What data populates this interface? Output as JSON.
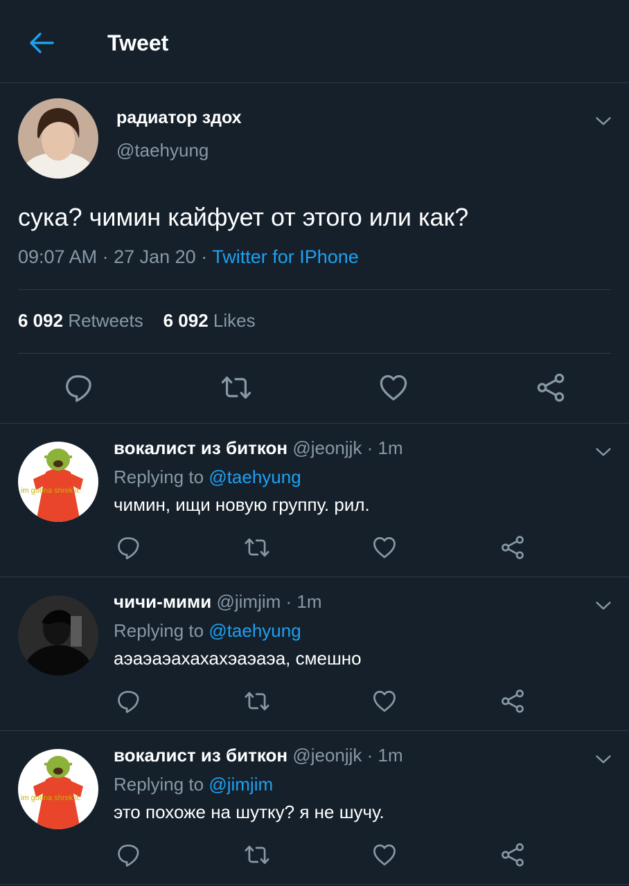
{
  "header": {
    "title": "Tweet"
  },
  "tweet": {
    "author_name": "радиатор здох",
    "author_handle": "@taehyung",
    "text": "сука? чимин кайфует от этого или как?",
    "time": "09:07 AM",
    "date": "27 Jan 20",
    "source": "Twitter for IPhone",
    "sep": " · ",
    "retweets_count": "6 092",
    "retweets_label": "Retweets",
    "likes_count": "6 092",
    "likes_label": "Likes"
  },
  "replies": [
    {
      "name": "вокалист из биткон",
      "handle": "@jeonjjk",
      "time": "1m",
      "replying_prefix": "Replying to ",
      "replying_to": "@taehyung",
      "text": "чимин, ищи новую группу. рил.",
      "avatar_caption": "im gonna shrek it."
    },
    {
      "name": "чичи-мими",
      "handle": "@jimjim",
      "time": "1m",
      "replying_prefix": "Replying to ",
      "replying_to": "@taehyung",
      "text": "аэаэаэахахахэаэаэа, смешно"
    },
    {
      "name": "вокалист из биткон",
      "handle": "@jeonjjk",
      "time": "1m",
      "replying_prefix": "Replying to ",
      "replying_to": "@jimjim",
      "text": "это похоже на шутку? я не шучу.",
      "avatar_caption": "im gonna shrek it."
    }
  ],
  "colors": {
    "background": "#15202b",
    "accent": "#1da1f2",
    "muted": "#8899a6",
    "divider": "#2f3b47"
  },
  "icons": [
    "back-arrow-icon",
    "chevron-down-icon",
    "reply-icon",
    "retweet-icon",
    "like-icon",
    "share-icon"
  ]
}
